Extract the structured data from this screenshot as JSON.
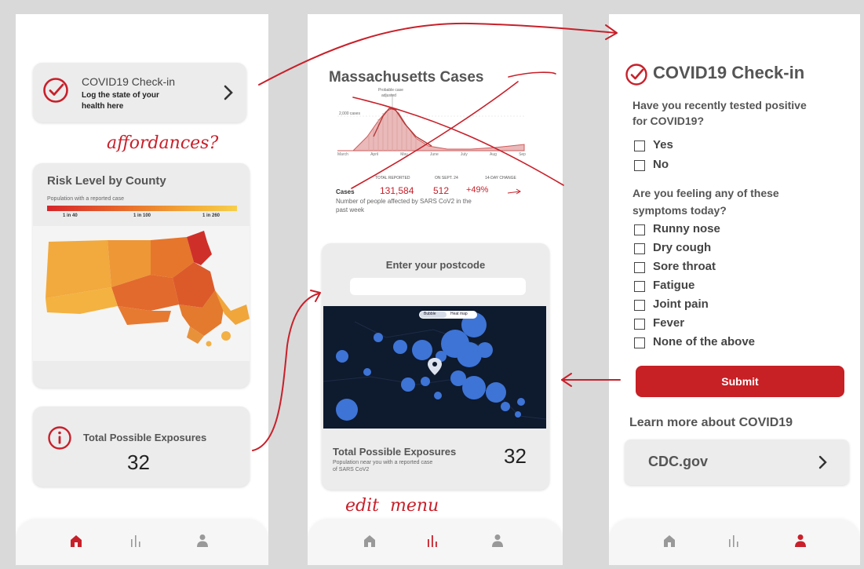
{
  "screen1": {
    "checkin_title": "COVID19 Check-in",
    "checkin_sub1": "Log the state of your",
    "checkin_sub2": "health here",
    "risk_title": "Risk Level by County",
    "risk_legend": "Population with a reported case",
    "risk_ticks": [
      "1 in 40",
      "1 in 100",
      "1 in 260"
    ],
    "exposures_title": "Total Possible Exposures",
    "exposures_value": "32"
  },
  "screen2": {
    "cases_title": "Massachusetts Cases",
    "chart_peak_label": "Probable case",
    "chart_peak_label2": "adjusted",
    "chart_y_label": "2,000 cases",
    "chart_months": [
      "March",
      "April",
      "May",
      "June",
      "July",
      "Aug",
      "Sep"
    ],
    "table_headers": [
      "TOTAL REPORTED",
      "ON SEPT. 24",
      "14-DAY CHANGE"
    ],
    "row_label": "Cases",
    "total_reported": "131,584",
    "on_date": "512",
    "change": "+49%",
    "cases_note1": "Number of people affected by SARS CoV2 in the",
    "cases_note2": "past week",
    "postcode_title": "Enter your postcode",
    "postcode_value": "",
    "map_toggle": [
      "Bubble",
      "Heat map"
    ],
    "exposures_title": "Total Possible Exposures",
    "exposures_note1": "Population near you with a reported case",
    "exposures_note2": "of SARS CoV2",
    "exposures_value": "32"
  },
  "screen3": {
    "checkin_title": "COVID19 Check-in",
    "q1_line1": "Have you recently tested positive",
    "q1_line2": "for COVID19?",
    "q1_options": [
      "Yes",
      "No"
    ],
    "q2_line1": "Are you feeling any of these",
    "q2_line2": "symptoms today?",
    "symptoms": [
      "Runny nose",
      "Dry cough",
      "Sore throat",
      "Fatigue",
      "Joint pain",
      "Fever",
      "None of the above"
    ],
    "submit_label": "Submit",
    "learn_more": "Learn more about COVID19",
    "cdc_link": "CDC.gov"
  },
  "annotations": {
    "affordances": "affordances?",
    "edit_menu": "edit  menu"
  },
  "colors": {
    "accent": "#c8202a",
    "submit_bg": "#c72025",
    "map_bg": "#0e1a2e",
    "bubble": "#3d74d6",
    "nav_inactive": "#999999"
  },
  "icons": [
    "check-circle-icon",
    "chevron-right-icon",
    "info-icon",
    "home-icon",
    "bar-chart-icon",
    "person-icon",
    "location-pin-icon",
    "trend-arrow-icon"
  ]
}
